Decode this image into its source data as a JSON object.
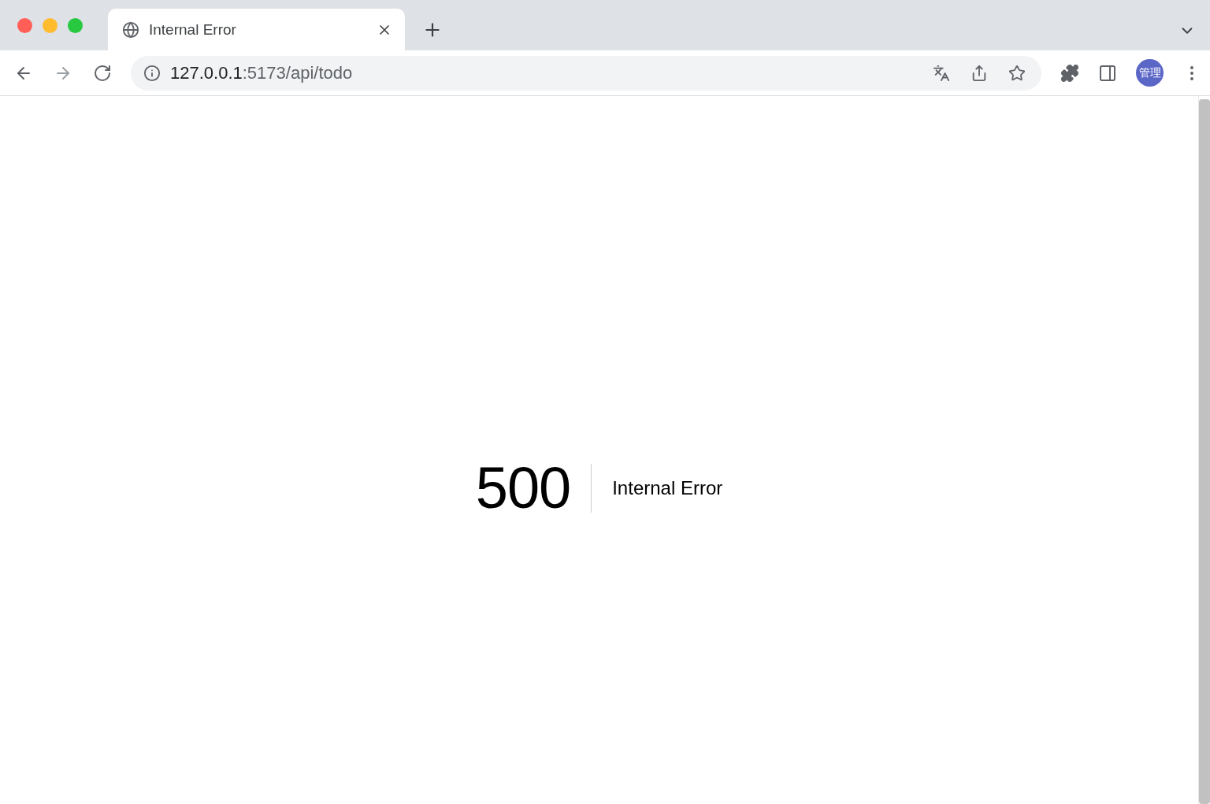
{
  "tabs": [
    {
      "title": "Internal Error",
      "selected": true
    }
  ],
  "nav": [
    {
      "kind": "back",
      "disabled": false
    },
    {
      "kind": "forward",
      "disabled": true
    },
    {
      "kind": "reload",
      "disabled": false
    }
  ],
  "address": {
    "host": "127.0.0.1",
    "path": ":5173/api/todo"
  },
  "profile": {
    "initials": "管理"
  },
  "error": {
    "code": "500",
    "message": "Internal Error"
  }
}
